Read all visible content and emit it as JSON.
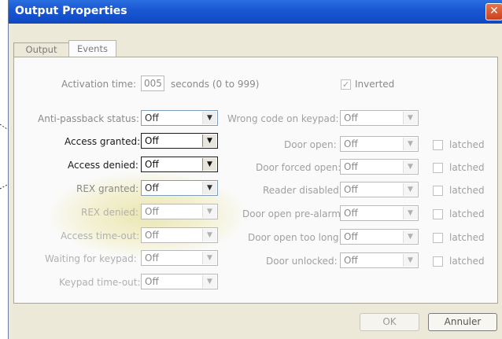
{
  "window": {
    "title": "Output Properties",
    "close_glyph": "✕"
  },
  "tabs": [
    {
      "label": "Output",
      "active": false
    },
    {
      "label": "Events",
      "active": true
    }
  ],
  "activation": {
    "label": "Activation time:",
    "value": "005",
    "unit": "seconds (0 to 999)",
    "inverted_label": "Inverted",
    "inverted_checked": true
  },
  "left_events": [
    {
      "label": "Anti-passback status:",
      "value": "Off",
      "state": "enabled"
    },
    {
      "label": "Access granted:",
      "value": "Off",
      "state": "active"
    },
    {
      "label": "Access denied:",
      "value": "Off",
      "state": "active"
    },
    {
      "label": "REX granted:",
      "value": "Off",
      "state": "enabled"
    },
    {
      "label": "REX denied:",
      "value": "Off",
      "state": "disabled"
    },
    {
      "label": "Access time-out:",
      "value": "Off",
      "state": "disabled"
    },
    {
      "label": "Waiting for keypad:",
      "value": "Off",
      "state": "disabled"
    },
    {
      "label": "Keypad time-out:",
      "value": "Off",
      "state": "disabled"
    }
  ],
  "right_events": [
    {
      "label": "Wrong code on keypad:",
      "value": "Off",
      "latched": null
    },
    {
      "label": "Door open:",
      "value": "Off",
      "latched": "latched"
    },
    {
      "label": "Door forced open:",
      "value": "Off",
      "latched": "latched"
    },
    {
      "label": "Reader disabled:",
      "value": "Off",
      "latched": "latched"
    },
    {
      "label": "Door open pre-alarm:",
      "value": "Off",
      "latched": "latched"
    },
    {
      "label": "Door open too long:",
      "value": "Off",
      "latched": "latched"
    },
    {
      "label": "Door unlocked:",
      "value": "Off",
      "latched": "latched"
    }
  ],
  "buttons": {
    "ok": "OK",
    "cancel": "Annuler"
  },
  "icons": {
    "dropdown": "chevron-down-icon",
    "close": "close-icon",
    "check": "checkmark-icon"
  },
  "colors": {
    "titlebar": "#0f49c2",
    "dialog_bg": "#ece9d8",
    "highlight": "#e8e2a5"
  }
}
